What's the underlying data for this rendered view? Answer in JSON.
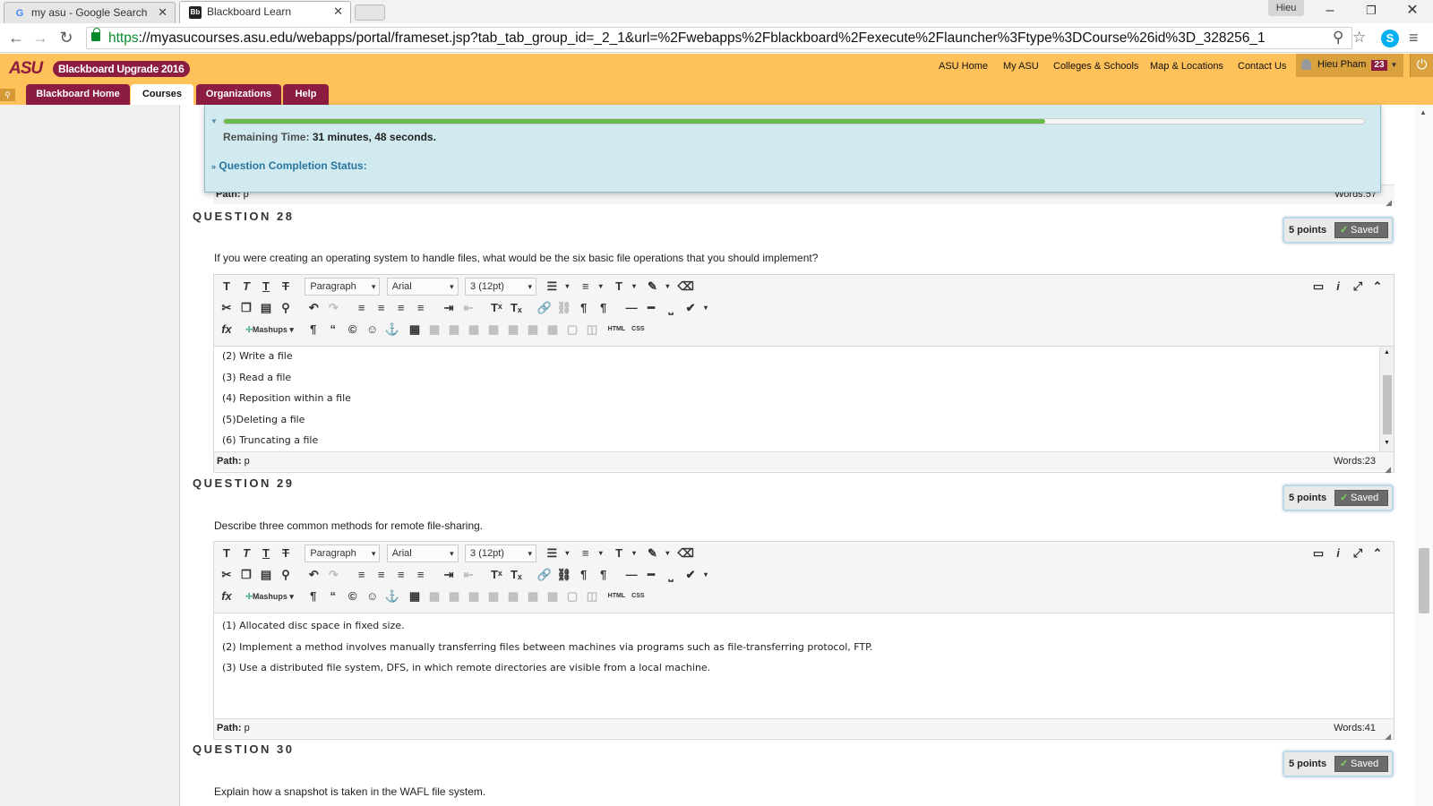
{
  "browser": {
    "tabs": [
      {
        "label": "my asu - Google Search",
        "favicon": "G"
      },
      {
        "label": "Blackboard Learn",
        "favicon": "Bb"
      }
    ],
    "profile": "Hieu",
    "url_scheme": "https",
    "url_rest": "://myasucourses.asu.edu/webapps/portal/frameset.jsp?tab_tab_group_id=_2_1&url=%2Fwebapps%2Fblackboard%2Fexecute%2Flauncher%3Ftype%3DCourse%26id%3D_328256_1"
  },
  "header": {
    "logo": "ASU",
    "upgrade_label": "Blackboard Upgrade 2016",
    "links": [
      "ASU Home",
      "My ASU",
      "Colleges & Schools",
      "Map & Locations",
      "Contact Us"
    ],
    "user_name": "Hieu Pham",
    "notification_count": "23",
    "tabs": [
      "Blackboard Home",
      "Courses",
      "Organizations",
      "Help"
    ],
    "brand_color": "#8c1d40",
    "accent_color": "#ffc15a"
  },
  "timer": {
    "label": "Remaining Time:",
    "minutes": "31",
    "minutes_unit": "minutes,",
    "seconds": "48",
    "seconds_unit": "seconds.",
    "progress_fraction": 0.72,
    "status_label": "Question Completion Status:"
  },
  "prev_path": {
    "path_label": "Path:",
    "path_value": "p",
    "words": "Words:57"
  },
  "toolbar": {
    "format": "Paragraph",
    "font": "Arial",
    "size": "3 (12pt)",
    "mashups": "Mashups",
    "html": "HTML",
    "css": "CSS"
  },
  "questions": [
    {
      "heading": "QUESTION 28",
      "points": "5 points",
      "saved": "Saved",
      "text": "If you were creating an operating system to handle files, what would be the six basic file operations that you should implement?",
      "answer": [
        "(2) Write a file",
        "(3) Read a file",
        "(4) Reposition within a file",
        "(5)Deleting a file",
        "(6) Truncating a file"
      ],
      "path_label": "Path:",
      "path_value": "p",
      "words": "Words:23"
    },
    {
      "heading": "QUESTION 29",
      "points": "5 points",
      "saved": "Saved",
      "text": "Describe three common methods for remote file-sharing.",
      "answer": [
        "(1) Allocated disc space in fixed size.",
        "(2) Implement a method involves manually transferring files between machines via programs such as file-transferring protocol, FTP.",
        "(3) Use a distributed file system, DFS, in which remote directories are visible from a local machine."
      ],
      "path_label": "Path:",
      "path_value": "p",
      "words": "Words:41"
    },
    {
      "heading": "QUESTION 30",
      "points": "5 points",
      "saved": "Saved",
      "text": "Explain how a snapshot is taken in the WAFL file system."
    }
  ]
}
